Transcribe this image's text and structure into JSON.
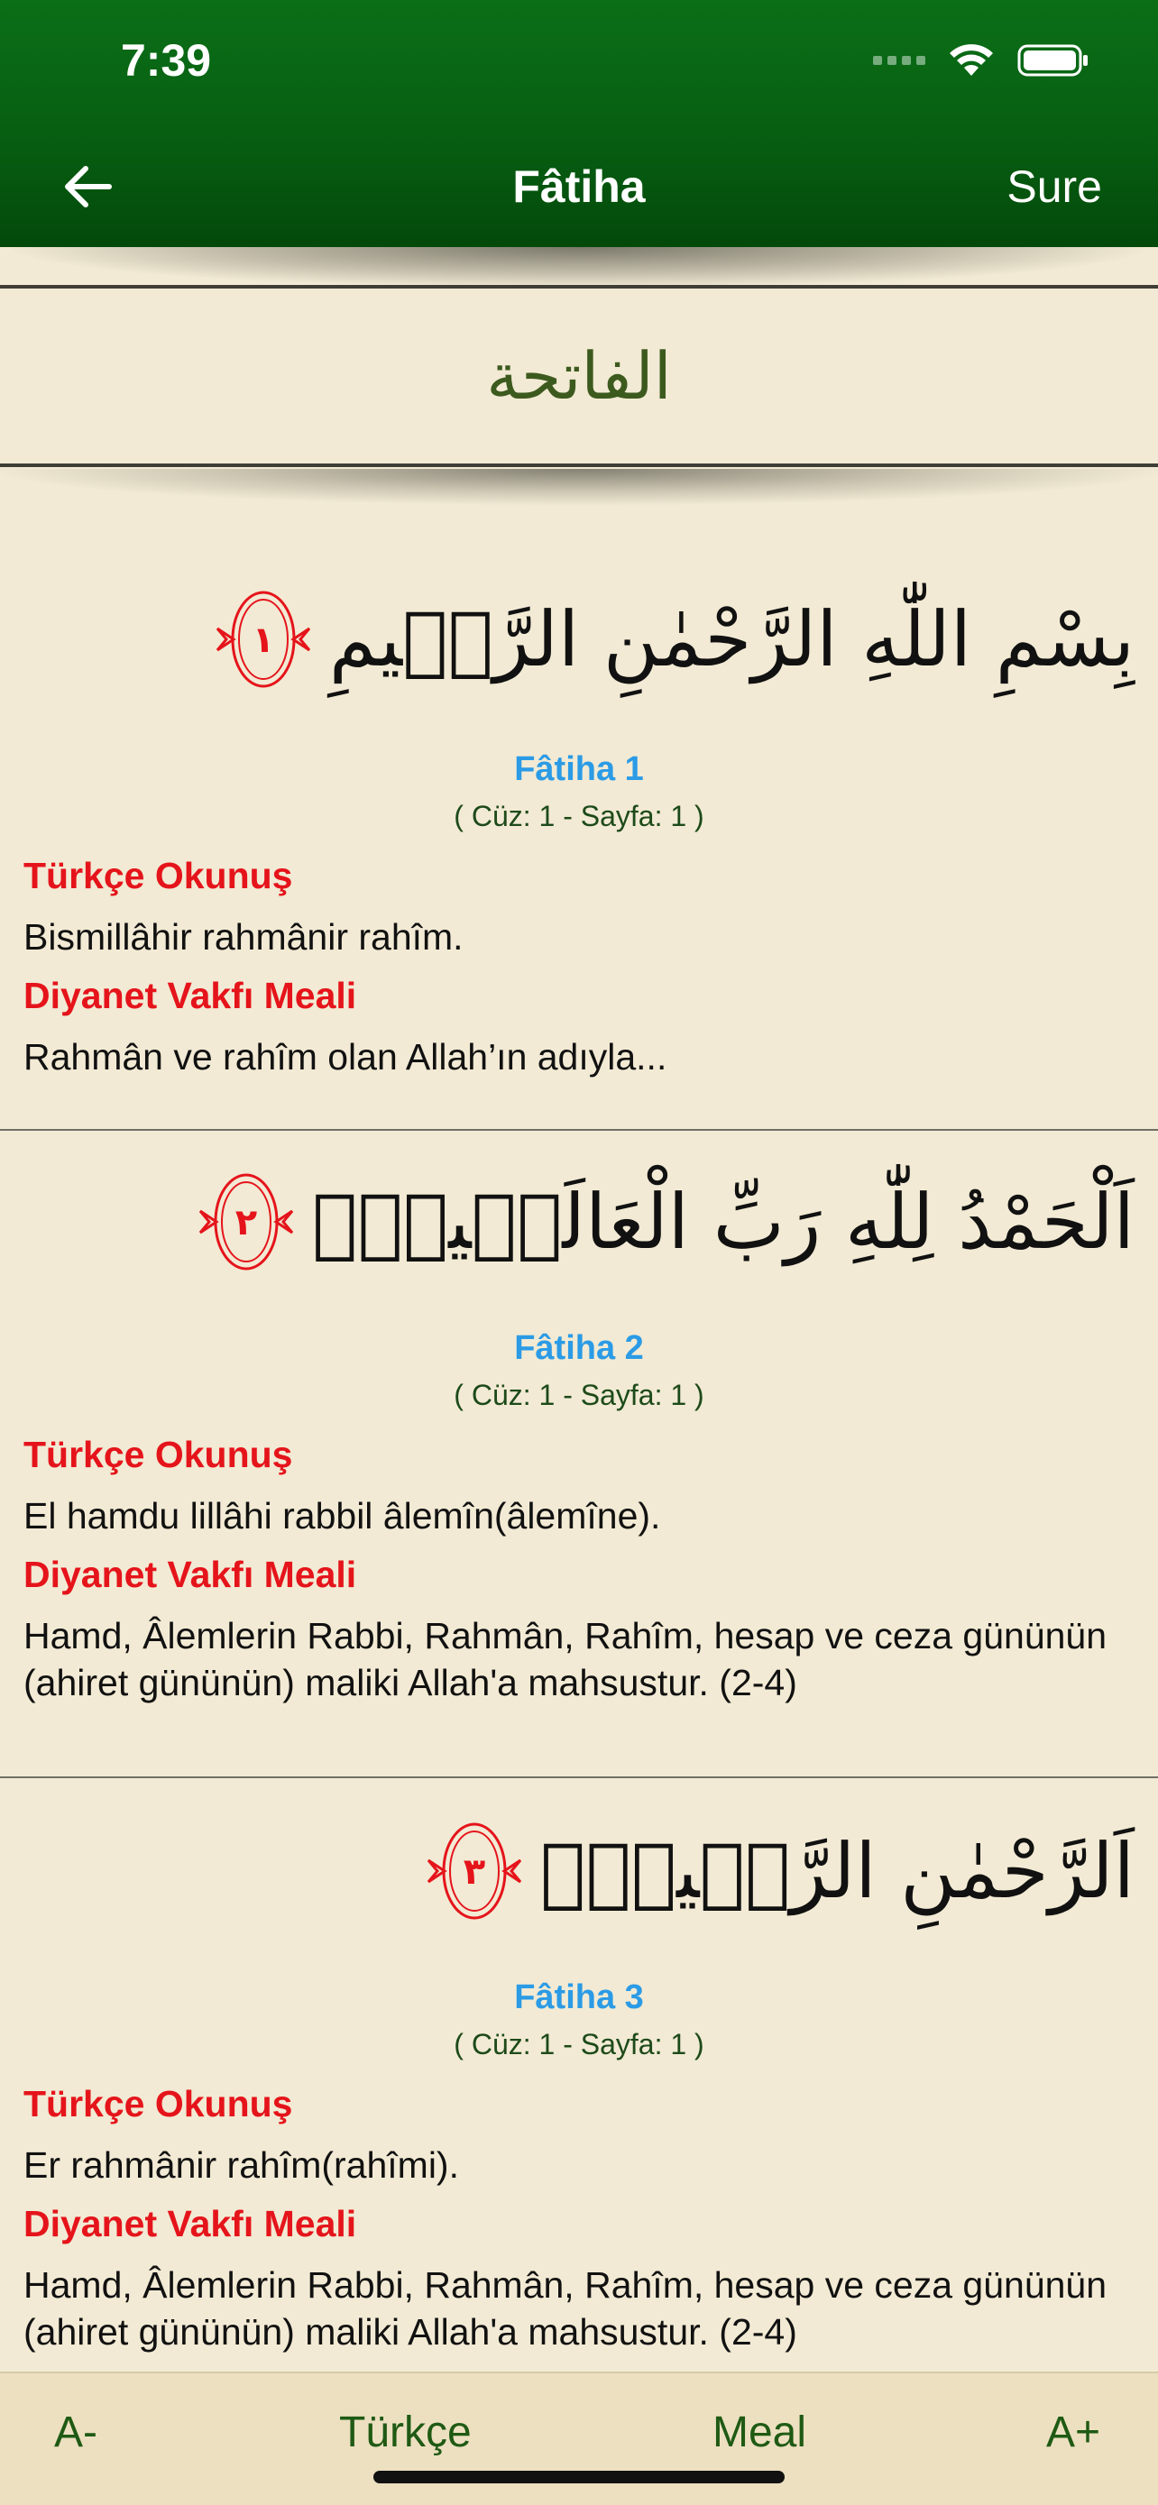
{
  "status_bar": {
    "time": "7:39"
  },
  "header": {
    "back_label": "back",
    "title": "Fâtiha",
    "right_action": "Sure"
  },
  "surah": {
    "arabic_name": "الفاتحة"
  },
  "labels": {
    "transliteration_title": "Türkçe Okunuş",
    "translation_title": "Diyanet Vakfı Meali"
  },
  "verses": [
    {
      "arabic": "بِسْمِ اللّٰهِ الرَّحْمٰنِ الرَّح۪يمِ",
      "ayah_number": "١",
      "reference": "Fâtiha 1",
      "location": "( Cüz: 1 - Sayfa: 1 )",
      "transliteration": "Bismillâhir rahmânir rahîm.",
      "translation": "Rahmân ve rahîm olan Allah’ın adıyla..."
    },
    {
      "arabic": "اَلْحَمْدُ لِلّٰهِ رَبِّ الْعَالَم۪ينَۙ",
      "ayah_number": "٢",
      "reference": "Fâtiha 2",
      "location": "( Cüz: 1 - Sayfa: 1 )",
      "transliteration": "El hamdu lillâhi rabbil âlemîn(âlemîne).",
      "translation": "Hamd, Âlemlerin Rabbi, Rahmân, Rahîm, hesap ve ceza gününün (ahiret gününün) maliki Allah'a mahsustur. (2-4)"
    },
    {
      "arabic": "اَلرَّحْمٰنِ الرَّح۪يمِۙ",
      "ayah_number": "٣",
      "reference": "Fâtiha 3",
      "location": "( Cüz: 1 - Sayfa: 1 )",
      "transliteration": "Er rahmânir rahîm(rahîmi).",
      "translation": "Hamd, Âlemlerin Rabbi, Rahmân, Rahîm, hesap ve ceza gününün (ahiret gününün) maliki Allah'a mahsustur. (2-4)"
    }
  ],
  "toolbar": {
    "decrease_font": "A-",
    "turkish": "Türkçe",
    "meal": "Meal",
    "increase_font": "A+"
  },
  "colors": {
    "header_green": "#075f12",
    "background": "#f2ead4",
    "section_red": "#e5141b",
    "reference_blue": "#2b9be6",
    "location_green": "#1d4a1a"
  }
}
